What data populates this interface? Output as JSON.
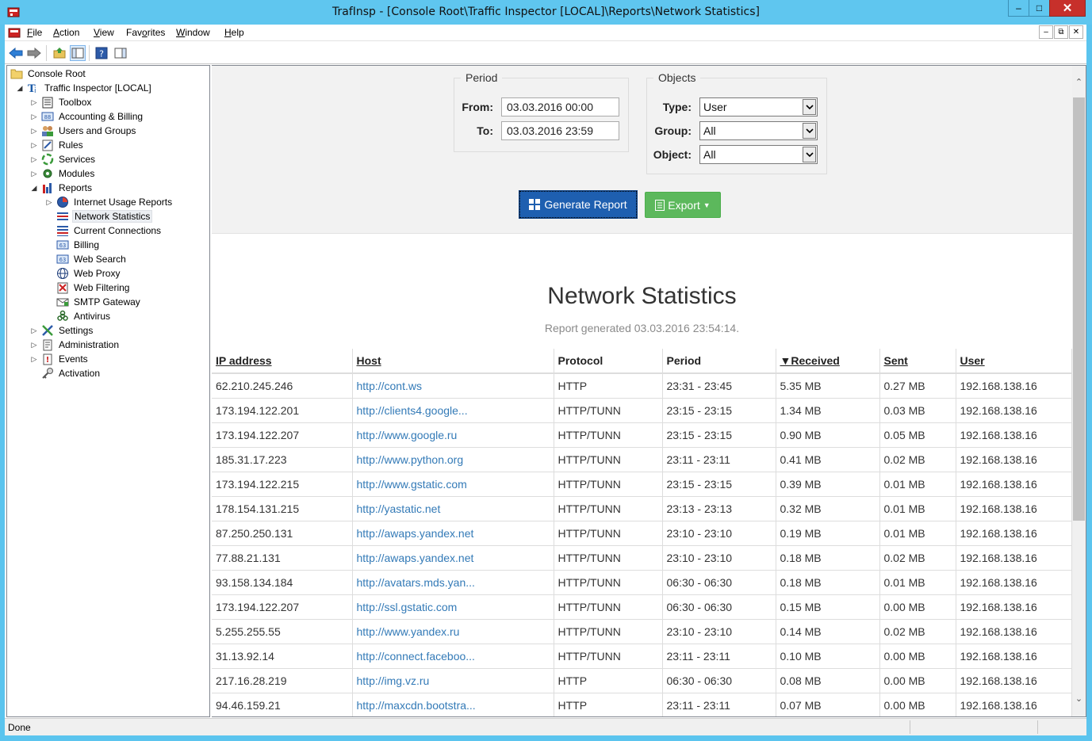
{
  "window": {
    "title": "TrafInsp - [Console Root\\Traffic Inspector [LOCAL]\\Reports\\Network Statistics]",
    "minimize": "‒",
    "maximize": "□",
    "close": "✕"
  },
  "menu": {
    "items": [
      {
        "accel": "F",
        "rest": "ile"
      },
      {
        "accel": "A",
        "rest": "ction"
      },
      {
        "accel": "V",
        "rest": "iew"
      },
      {
        "pre": "Fav",
        "accel": "o",
        "rest": "rites"
      },
      {
        "accel": "W",
        "rest": "indow"
      },
      {
        "accel": "H",
        "rest": "elp"
      }
    ]
  },
  "toolbar": {
    "icons": [
      "back-arrow-icon",
      "forward-arrow-icon",
      "up-folder-icon",
      "show-hide-tree-icon",
      "help-icon",
      "action-pane-icon"
    ]
  },
  "tree": {
    "root": "Console Root",
    "server": "Traffic Inspector [LOCAL]",
    "items": [
      "Toolbox",
      "Accounting & Billing",
      "Users and Groups",
      "Rules",
      "Services",
      "Modules",
      "Reports",
      "Internet Usage Reports",
      "Network Statistics",
      "Current Connections",
      "Billing",
      "Web Search",
      "Web Proxy",
      "Web Filtering",
      "SMTP Gateway",
      "Antivirus",
      "Settings",
      "Administration",
      "Events",
      "Activation"
    ]
  },
  "form": {
    "period_legend": "Period",
    "from_label": "From:",
    "from_value": "03.03.2016 00:00",
    "to_label": "To:",
    "to_value": "03.03.2016 23:59",
    "objects_legend": "Objects",
    "type_label": "Type:",
    "type_value": "User",
    "group_label": "Group:",
    "group_value": "All",
    "object_label": "Object:",
    "object_value": "All",
    "generate_label": "Generate Report",
    "export_label": "Export"
  },
  "report": {
    "title": "Network Statistics",
    "generated": "Report generated 03.03.2016 23:54:14.",
    "columns": [
      "IP address",
      "Host",
      "Protocol",
      "Period",
      "▼Received",
      "Sent",
      "User"
    ],
    "rows": [
      [
        "62.210.245.246",
        "http://cont.ws",
        "HTTP",
        "23:31 - 23:45",
        "5.35 MB",
        "0.27 MB",
        "192.168.138.16"
      ],
      [
        "173.194.122.201",
        "http://clients4.google...",
        "HTTP/TUNN",
        "23:15 - 23:15",
        "1.34 MB",
        "0.03 MB",
        "192.168.138.16"
      ],
      [
        "173.194.122.207",
        "http://www.google.ru",
        "HTTP/TUNN",
        "23:15 - 23:15",
        "0.90 MB",
        "0.05 MB",
        "192.168.138.16"
      ],
      [
        "185.31.17.223",
        "http://www.python.org",
        "HTTP/TUNN",
        "23:11 - 23:11",
        "0.41 MB",
        "0.02 MB",
        "192.168.138.16"
      ],
      [
        "173.194.122.215",
        "http://www.gstatic.com",
        "HTTP/TUNN",
        "23:15 - 23:15",
        "0.39 MB",
        "0.01 MB",
        "192.168.138.16"
      ],
      [
        "178.154.131.215",
        "http://yastatic.net",
        "HTTP/TUNN",
        "23:13 - 23:13",
        "0.32 MB",
        "0.01 MB",
        "192.168.138.16"
      ],
      [
        "87.250.250.131",
        "http://awaps.yandex.net",
        "HTTP/TUNN",
        "23:10 - 23:10",
        "0.19 MB",
        "0.01 MB",
        "192.168.138.16"
      ],
      [
        "77.88.21.131",
        "http://awaps.yandex.net",
        "HTTP/TUNN",
        "23:10 - 23:10",
        "0.18 MB",
        "0.02 MB",
        "192.168.138.16"
      ],
      [
        "93.158.134.184",
        "http://avatars.mds.yan...",
        "HTTP/TUNN",
        "06:30 - 06:30",
        "0.18 MB",
        "0.01 MB",
        "192.168.138.16"
      ],
      [
        "173.194.122.207",
        "http://ssl.gstatic.com",
        "HTTP/TUNN",
        "06:30 - 06:30",
        "0.15 MB",
        "0.00 MB",
        "192.168.138.16"
      ],
      [
        "5.255.255.55",
        "http://www.yandex.ru",
        "HTTP/TUNN",
        "23:10 - 23:10",
        "0.14 MB",
        "0.02 MB",
        "192.168.138.16"
      ],
      [
        "31.13.92.14",
        "http://connect.faceboo...",
        "HTTP/TUNN",
        "23:11 - 23:11",
        "0.10 MB",
        "0.00 MB",
        "192.168.138.16"
      ],
      [
        "217.16.28.219",
        "http://img.vz.ru",
        "HTTP",
        "06:30 - 06:30",
        "0.08 MB",
        "0.00 MB",
        "192.168.138.16"
      ],
      [
        "94.46.159.21",
        "http://maxcdn.bootstra...",
        "HTTP",
        "23:11 - 23:11",
        "0.07 MB",
        "0.00 MB",
        "192.168.138.16"
      ]
    ]
  },
  "status": {
    "text": "Done"
  },
  "colors": {
    "titlebar": "#5fc6ef",
    "generate_button": "#1e5fb0",
    "export_button": "#5cb85c",
    "link": "#337ab7",
    "close_button": "#c7302b"
  }
}
